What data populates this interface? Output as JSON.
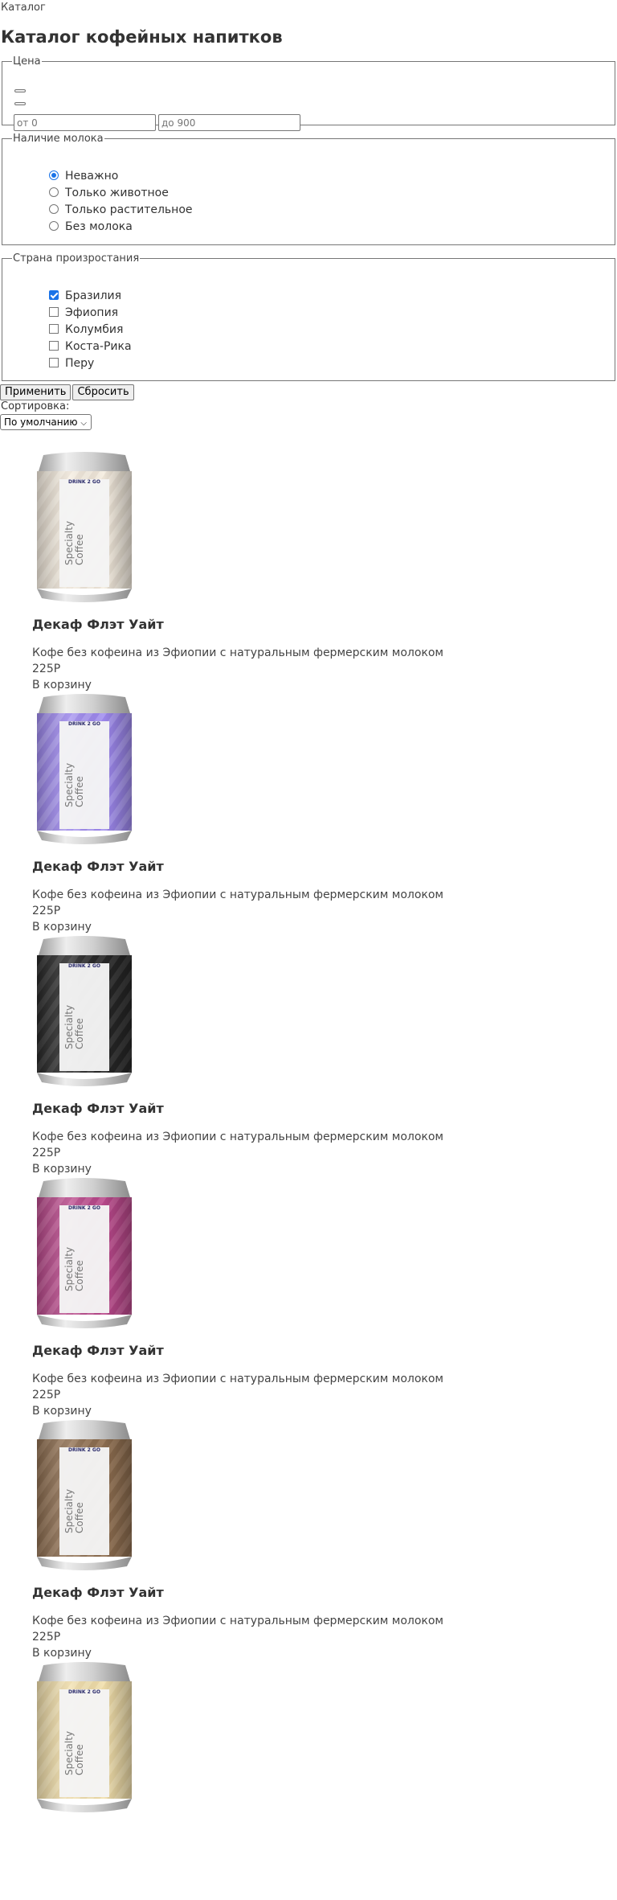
{
  "breadcrumb": "Каталог",
  "title": "Каталог кофейных напитков",
  "filters": {
    "price": {
      "legend": "Цена",
      "from_placeholder": "от 0",
      "to_placeholder": "до 900"
    },
    "milk": {
      "legend": "Наличие молока",
      "options": [
        "Неважно",
        "Только животное",
        "Только растительное",
        "Без молока"
      ],
      "selected": "Неважно"
    },
    "country": {
      "legend": "Страна произростания",
      "options": [
        "Бразилия",
        "Эфиопия",
        "Колумбия",
        "Коста-Рика",
        "Перу"
      ],
      "checked": [
        "Бразилия"
      ]
    },
    "apply_label": "Применить",
    "reset_label": "Сбросить"
  },
  "sort": {
    "label": "Сортировка:",
    "value": "По умолчанию"
  },
  "products": [
    {
      "title": "Декаф Флэт Уайт",
      "description": "Кофе без кофеина из Эфиопии с натуральным фермерским молоком",
      "price": "225Р",
      "cart_label": "В корзину",
      "can_color": "#ece3d6",
      "can_stripe": "#f6efe3"
    },
    {
      "title": "Декаф Флэт Уайт",
      "description": "Кофе без кофеина из Эфиопии с натуральным фермерским молоком",
      "price": "225Р",
      "cart_label": "В корзину",
      "can_color": "#9b86ea",
      "can_stripe": "#ad9cf2"
    },
    {
      "title": "Декаф Флэт Уайт",
      "description": "Кофе без кофеина из Эфиопии с натуральным фермерским молоком",
      "price": "225Р",
      "cart_label": "В корзину",
      "can_color": "#262626",
      "can_stripe": "#3a3a3a"
    },
    {
      "title": "Декаф Флэт Уайт",
      "description": "Кофе без кофеина из Эфиопии с натуральным фермерским молоком",
      "price": "225Р",
      "cart_label": "В корзину",
      "can_color": "#b54788",
      "can_stripe": "#c35c98"
    },
    {
      "title": "Декаф Флэт Уайт",
      "description": "Кофе без кофеина из Эфиопии с натуральным фермерским молоком",
      "price": "225Р",
      "cart_label": "В корзину",
      "can_color": "#8a6b4e",
      "can_stripe": "#9a7b5e"
    },
    {
      "title": "",
      "description": "",
      "price": "",
      "cart_label": "",
      "can_color": "#ecd9a6",
      "can_stripe": "#f3e3b5"
    }
  ],
  "can_label": {
    "brand": "DRINK 2 GO",
    "text_line1": "Specialty",
    "text_line2": "Coffee"
  }
}
